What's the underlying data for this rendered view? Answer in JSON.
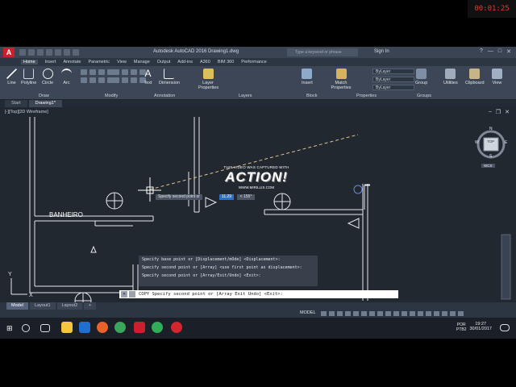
{
  "app": {
    "title": "Autodesk AutoCAD 2016    Drawing1.dwg",
    "search_placeholder": "Type a keyword or phrase",
    "sign_in": "Sign In",
    "help": "?"
  },
  "ribbon_tabs": [
    "Home",
    "Insert",
    "Annotate",
    "Parametric",
    "View",
    "Manage",
    "Output",
    "Add-ins",
    "A360",
    "BIM 360",
    "Performance"
  ],
  "ribbon_tools": {
    "line": "Line",
    "polyline": "Polyline",
    "circle": "Circle",
    "arc": "Arc",
    "text": "Text",
    "dimension": "Dimension",
    "layer_properties": "Layer Properties",
    "insert": "Insert",
    "match_properties": "Match Properties",
    "group": "Group",
    "utilities": "Utilities",
    "clipboard": "Clipboard",
    "view": "View"
  },
  "ribbon_panels": [
    "Draw",
    "Modify",
    "Annotation",
    "Layers",
    "Block",
    "Properties",
    "Groups"
  ],
  "properties": {
    "bylayer_1": "ByLayer",
    "bylayer_2": "ByLayer",
    "bylayer_3": "ByLayer"
  },
  "file_tabs": [
    "Start",
    "Drawing1*"
  ],
  "viewport_label": "[-][Top][2D Wireframe]",
  "room_label": "BANHEIRO",
  "dynamic_input": {
    "prompt": "Specify second point or",
    "distance": "11.29",
    "angle": "< 155°"
  },
  "command_history": [
    "Specify base point or [Displacement/mOde] <Displacement>:",
    "Specify second point or [Array] <use first point as displacement>:",
    "Specify second point or [Array/Exit/Undo] <Exit>:"
  ],
  "command_line": "COPY Specify second point or [Array Exit Undo] <Exit>:",
  "layout_tabs": [
    "Model",
    "Layout1",
    "Layout2"
  ],
  "status": {
    "model": "MODEL"
  },
  "viewcube": {
    "top": "TOP",
    "n": "N",
    "s": "S",
    "e": "E",
    "w": "W",
    "wcs": "WCS"
  },
  "watermark": {
    "line1": "THIS VIDEO WAS CAPTURED WITH",
    "line2": "ACTION!",
    "line3": "WWW.MIRILLIS.COM"
  },
  "recording_timer": "00:01:25",
  "taskbar": {
    "lang": "POR",
    "lang2": "PTB2",
    "time": "19:27",
    "date": "30/01/2017"
  },
  "colors": {
    "accent_blue": "#2e6fd4",
    "drawing_bg": "#212830",
    "autocad_red": "#c8202c"
  }
}
